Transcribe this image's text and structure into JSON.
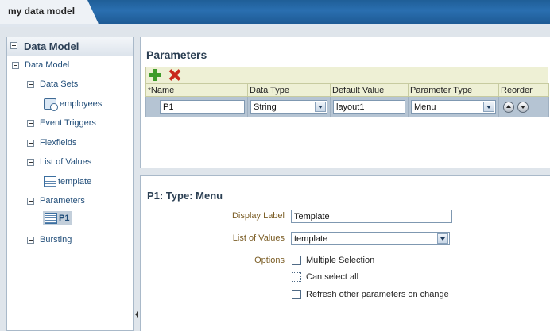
{
  "window": {
    "tab_title": "my data model"
  },
  "sidebar": {
    "title": "Data Model",
    "tree": {
      "root": "Data Model",
      "data_sets": "Data Sets",
      "employees": "employees",
      "event_triggers": "Event Triggers",
      "flexfields": "Flexfields",
      "list_of_values": "List of Values",
      "template": "template",
      "parameters": "Parameters",
      "p1": "P1",
      "bursting": "Bursting"
    }
  },
  "parameters": {
    "title": "Parameters",
    "columns": {
      "required_mark": "*",
      "name": "Name",
      "data_type": "Data Type",
      "default_value": "Default Value",
      "parameter_type": "Parameter Type",
      "reorder": "Reorder"
    },
    "rows": [
      {
        "name": "P1",
        "data_type": "String",
        "default_value": "layout1",
        "parameter_type": "Menu"
      }
    ]
  },
  "detail": {
    "title": "P1: Type: Menu",
    "display_label_label": "Display Label",
    "display_label_value": "Template",
    "list_of_values_label": "List of Values",
    "list_of_values_value": "template",
    "options_label": "Options",
    "options": {
      "multiple_selection": "Multiple Selection",
      "can_select_all": "Can select all",
      "refresh_other": "Refresh other parameters on change"
    }
  },
  "colors": {
    "header_blue": "#2a6fb0",
    "table_header": "#eef0d5",
    "selected_row": "#b5c4d3",
    "label_brown": "#7b5d25"
  },
  "icons": [
    "add-icon",
    "delete-icon",
    "move-up-icon",
    "move-down-icon",
    "data-set-icon",
    "list-of-values-icon",
    "parameter-icon"
  ]
}
